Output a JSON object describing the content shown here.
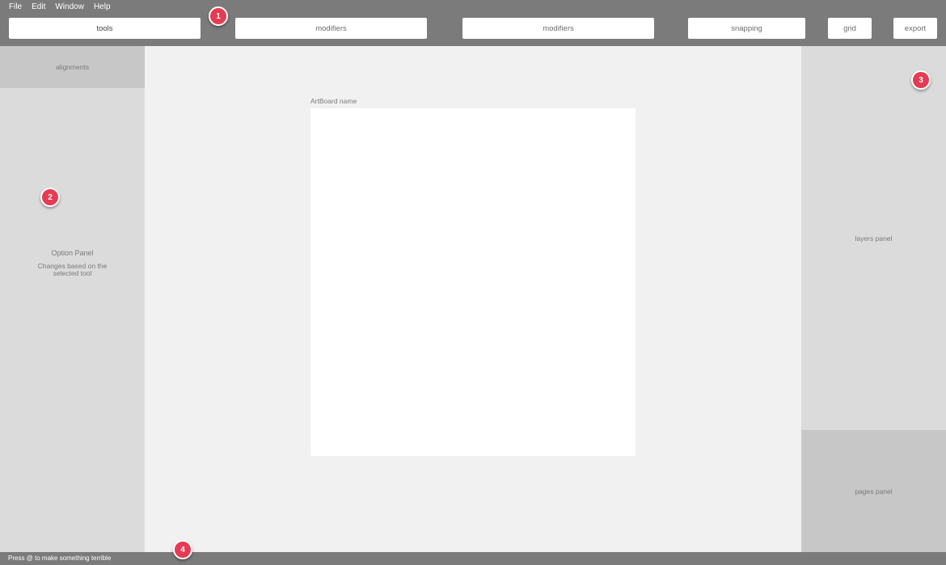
{
  "menu": [
    "File",
    "Edit",
    "Window",
    "Help"
  ],
  "toolbar": {
    "tools": "tools",
    "modifiers_1": "modifiers",
    "modifiers_2": "modifiers",
    "snapping": "snapping",
    "grid": "grid",
    "export": "export"
  },
  "left_panel": {
    "alignments": "alignments",
    "option_title": "Option Panel",
    "option_desc": "Changes based on the selected tool"
  },
  "canvas": {
    "artboard_name": "ArtBoard name"
  },
  "right_panel": {
    "layers": "layers panel",
    "pages": "pages panel"
  },
  "status": {
    "text": "Press @ to make something terrible"
  },
  "markers": [
    "1",
    "2",
    "3",
    "4"
  ],
  "colors": {
    "chrome": "#7b7b7b",
    "panel_light": "#dbdbdb",
    "panel_dark": "#c7c7c7",
    "canvas": "#f1f1f1",
    "marker": "#e63b52"
  }
}
